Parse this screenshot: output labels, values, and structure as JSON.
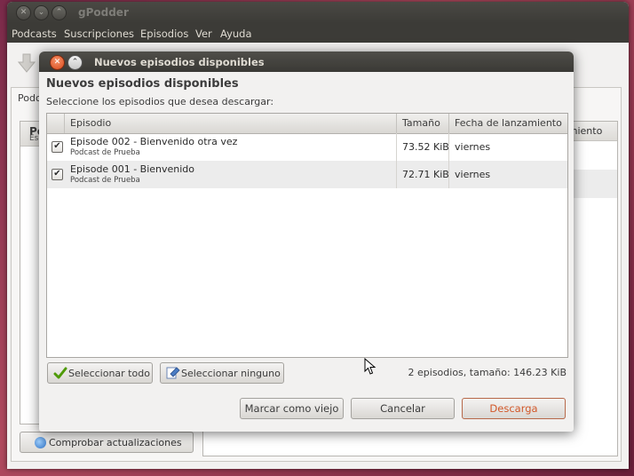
{
  "main_window": {
    "title": "gPodder",
    "menu": [
      "Podcasts",
      "Suscripciones",
      "Episodios",
      "Ver",
      "Ayuda"
    ],
    "tab_label": "Podc",
    "left_pane_header": "Po",
    "left_pane_sub": "Es",
    "right_pane_header": "amiento",
    "check_updates_label": "Comprobar actualizaciones"
  },
  "dialog": {
    "title": "Nuevos episodios disponibles",
    "heading": "Nuevos episodios disponibles",
    "subtitle": "Seleccione los episodios que desea descargar:",
    "columns": [
      "Episodio",
      "Tamaño",
      "Fecha de lanzamiento"
    ],
    "episodes": [
      {
        "checked": true,
        "title": "Episode 002 - Bienvenido otra vez",
        "podcast": "Podcast de Prueba",
        "size": "73.52 KiB",
        "date": "viernes"
      },
      {
        "checked": true,
        "title": "Episode 001 - Bienvenido",
        "podcast": "Podcast de Prueba",
        "size": "72.71 KiB",
        "date": "viernes"
      }
    ],
    "select_all_label": "Seleccionar todo",
    "select_none_label": "Seleccionar ninguno",
    "summary": "2 episodios, tamaño: 146.23 KiB",
    "mark_old_label": "Marcar como viejo",
    "cancel_label": "Cancelar",
    "download_label": "Descarga",
    "check_glyph": "✔"
  },
  "colors": {
    "titlebar": "#3c3b37",
    "accent": "#d2582a",
    "close_button": "#d9481a"
  }
}
